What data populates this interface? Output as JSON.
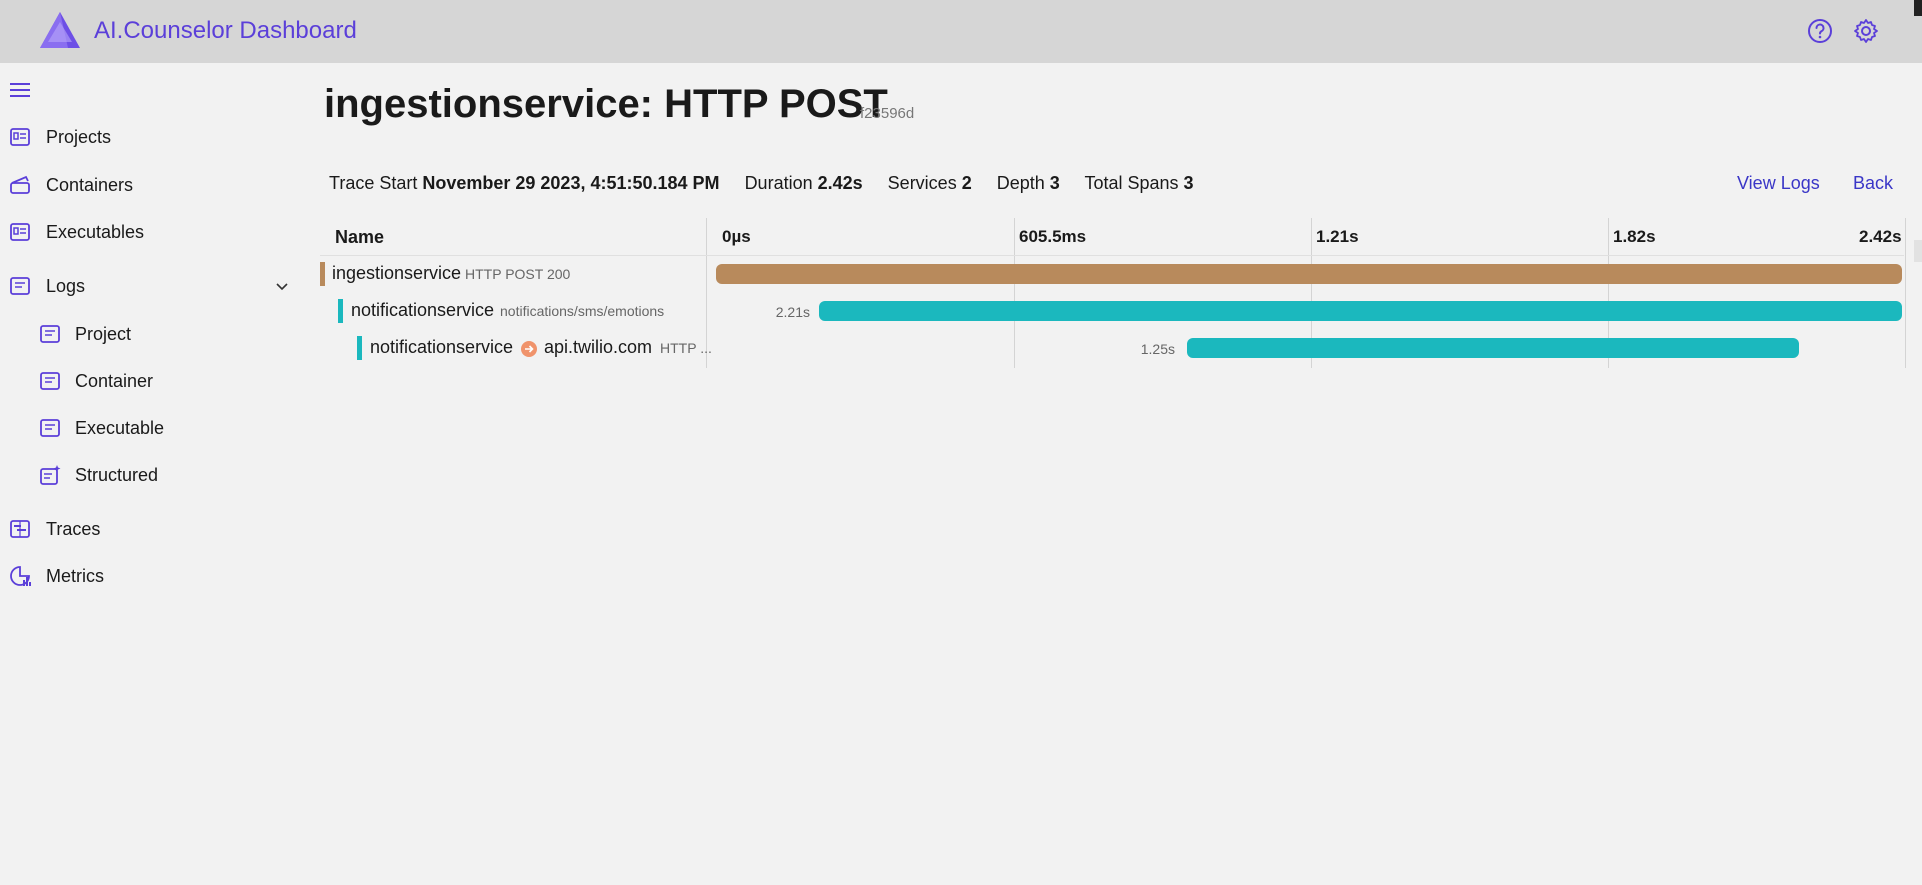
{
  "header": {
    "app_title": "AI.Counselor Dashboard",
    "help_icon": "help-circle-icon",
    "settings_icon": "gear-icon",
    "brand_color": "#5b3fd9"
  },
  "sidebar": {
    "items": [
      {
        "label": "Projects",
        "icon": "projects-icon"
      },
      {
        "label": "Containers",
        "icon": "containers-icon"
      },
      {
        "label": "Executables",
        "icon": "executables-icon"
      },
      {
        "label": "Logs",
        "icon": "logs-icon"
      },
      {
        "label": "Project",
        "icon": "log-project-icon"
      },
      {
        "label": "Container",
        "icon": "log-container-icon"
      },
      {
        "label": "Executable",
        "icon": "log-executable-icon"
      },
      {
        "label": "Structured",
        "icon": "structured-logs-icon"
      },
      {
        "label": "Traces",
        "icon": "traces-icon"
      },
      {
        "label": "Metrics",
        "icon": "metrics-icon"
      }
    ]
  },
  "page": {
    "title": "ingestionservice: HTTP POST",
    "trace_id": "f23596d"
  },
  "summary": {
    "trace_start_label": "Trace Start",
    "trace_start_value": "November 29 2023, 4:51:50.184 PM",
    "duration_label": "Duration",
    "duration_value": "2.42s",
    "services_label": "Services",
    "services_value": "2",
    "depth_label": "Depth",
    "depth_value": "3",
    "total_spans_label": "Total Spans",
    "total_spans_value": "3",
    "view_logs": "View Logs",
    "back": "Back"
  },
  "table": {
    "name_header": "Name",
    "ticks": [
      "0µs",
      "605.5ms",
      "1.21s",
      "1.82s",
      "2.42s"
    ],
    "total_duration_s": 2.42,
    "rows": [
      {
        "service": "ingestionservice",
        "operation": "HTTP POST 200",
        "peer": "",
        "duration_label": "",
        "start_s": 0.0,
        "duration_s": 2.42,
        "color": "#b88a5c"
      },
      {
        "service": "notificationservice",
        "operation": "notifications/sms/emotions",
        "peer": "",
        "duration_label": "2.21s",
        "start_s": 0.21,
        "duration_s": 2.21,
        "color": "#1bb8be"
      },
      {
        "service": "notificationservice",
        "operation": "HTTP ...",
        "peer": "api.twilio.com",
        "duration_label": "1.25s",
        "start_s": 0.96,
        "duration_s": 1.25,
        "color": "#1bb8be"
      }
    ]
  }
}
